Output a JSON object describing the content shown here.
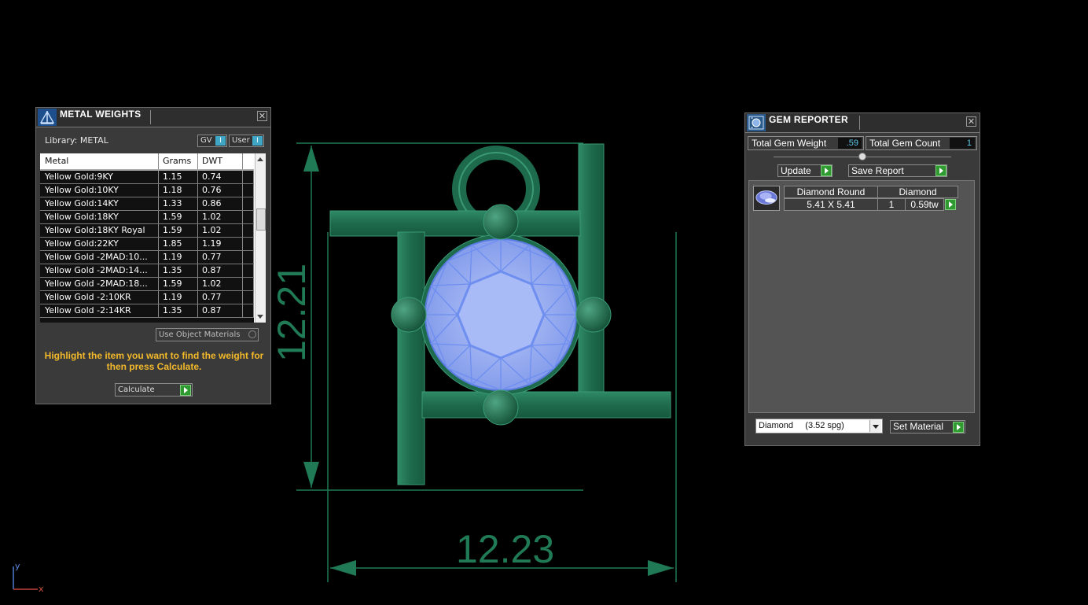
{
  "viewport": {
    "dim_width": "12.23",
    "dim_height": "12.21",
    "axis_x": "x",
    "axis_y": "y",
    "colors": {
      "model": "#1f6e4e",
      "stone": "#8da6f5",
      "dimension": "#1f7a55"
    }
  },
  "metal_weights": {
    "title": "METAL WEIGHTS",
    "library_label": "Library: METAL",
    "toggles": {
      "gv_label": "GV",
      "gv_indicator": "I",
      "user_label": "User",
      "user_indicator": "I"
    },
    "columns": [
      "Metal",
      "Grams",
      "DWT"
    ],
    "rows": [
      {
        "metal": "Yellow Gold:9KY",
        "grams": "1.15",
        "dwt": "0.74"
      },
      {
        "metal": "Yellow Gold:10KY",
        "grams": "1.18",
        "dwt": "0.76"
      },
      {
        "metal": "Yellow Gold:14KY",
        "grams": "1.33",
        "dwt": "0.86"
      },
      {
        "metal": "Yellow Gold:18KY",
        "grams": "1.59",
        "dwt": "1.02"
      },
      {
        "metal": "Yellow Gold:18KY Royal",
        "grams": "1.59",
        "dwt": "1.02"
      },
      {
        "metal": "Yellow Gold:22KY",
        "grams": "1.85",
        "dwt": "1.19"
      },
      {
        "metal": "Yellow Gold -2MAD:10...",
        "grams": "1.19",
        "dwt": "0.77"
      },
      {
        "metal": "Yellow Gold -2MAD:14...",
        "grams": "1.35",
        "dwt": "0.87"
      },
      {
        "metal": "Yellow Gold -2MAD:18...",
        "grams": "1.59",
        "dwt": "1.02"
      },
      {
        "metal": "Yellow Gold -2:10KR",
        "grams": "1.19",
        "dwt": "0.77"
      },
      {
        "metal": "Yellow Gold -2:14KR",
        "grams": "1.35",
        "dwt": "0.87"
      }
    ],
    "use_object_materials": "Use Object Materials",
    "hint": "Highlight the item you want to find the weight for then press Calculate.",
    "calculate_label": "Calculate",
    "hint_color": "#f3b92a"
  },
  "gem_reporter": {
    "title": "GEM REPORTER",
    "total_weight_label": "Total Gem Weight",
    "total_weight_value": ".59",
    "total_count_label": "Total Gem Count",
    "total_count_value": "1",
    "update_label": "Update",
    "save_report_label": "Save Report",
    "gem": {
      "name": "Diamond Round",
      "material": "Diamond",
      "size": "5.41 X 5.41",
      "count": "1",
      "weight": "0.59tw"
    },
    "material_select": "Diamond     (3.52 spg)",
    "set_material_label": "Set Material"
  }
}
